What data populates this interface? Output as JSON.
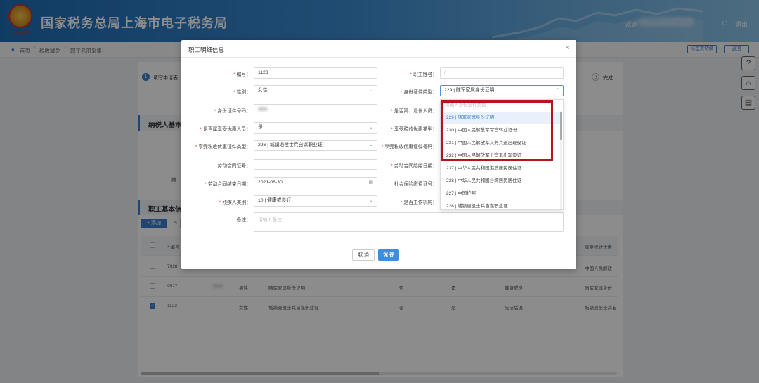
{
  "header": {
    "title": "国家税务总局上海市电子税务局",
    "emblem_text": "中国税务",
    "welcome": "欢迎",
    "logout": "退出"
  },
  "breadcrumb": {
    "items": [
      "首页",
      "税收减免",
      "职工名册采集"
    ],
    "right_buttons": [
      "标签页切换",
      "返回"
    ]
  },
  "steps": [
    {
      "num": "1",
      "label": "填写申请表"
    },
    {
      "num": "3",
      "label": "完成"
    }
  ],
  "sections": {
    "taxpayer": "纳税人基本",
    "taxpayer_row_label": "纳",
    "employee": "职工基本信",
    "add": "+ 添加"
  },
  "table": {
    "headers": [
      "* 编号",
      "享受税收优惠"
    ],
    "rows": [
      {
        "id": "7928",
        "name": "",
        "gender": "",
        "doc_type": "",
        "c5": "",
        "c6": "",
        "c7": "",
        "c8": "",
        "tail": "中国人民解放",
        "checked": false
      },
      {
        "id": "9527",
        "name": "",
        "gender": "男性",
        "doc_type": "随军家属身份证明",
        "c5": "否",
        "c6": "是",
        "c7": "健康或良",
        "c8": "",
        "tail": "随军家属身份",
        "checked": false
      },
      {
        "id": "1123",
        "name": "",
        "gender": "女性",
        "doc_type": "城镇退役士兵自谋职业证",
        "c5": "否",
        "c6": "是",
        "c7": "先证后退",
        "c8": "",
        "tail": "城镇退役士兵自",
        "checked": true
      }
    ]
  },
  "modal": {
    "title": "职工明细信息",
    "close": "×",
    "fields": {
      "number_label": "编号：",
      "number_value": "1123",
      "name_label": "职工姓名：",
      "gender_label": "性别：",
      "gender_value": "女性",
      "idtype_label": "身份证件类型：",
      "idtype_value": "229 | 随军家属身份证明",
      "idno_label": "身份证件号码：",
      "retired_label": "是否离、退休人员：",
      "preferential_label": "是否属享受优惠人员：",
      "preferential_value": "是",
      "taxpref_label": "享受税收优惠类型：",
      "prefdoc_type_label": "享受税收优惠证件类型：",
      "prefdoc_type_value": "226 | 城镇退役士兵自谋职业证",
      "prefdoc_no_label": "享受税收优惠证件号码：",
      "contract_no_label": "劳动合同证号：",
      "contract_no_value": "-",
      "contract_start_label": "劳动合同起始日期：",
      "contract_end_label": "劳动合同结束日期：",
      "contract_end_value": "2021-06-30",
      "social_label": "社会保险缴费证号：",
      "disability_label": "残疾人类别：",
      "disability_value": "10 | 健康或良好",
      "workplace_label": "是否工作机构：",
      "remark_label": "备注：",
      "remark_placeholder": "请输入备注"
    },
    "cancel": "取 消",
    "save": "保 存"
  },
  "dropdown": {
    "search_placeholder": "请输入身份证件类型",
    "options": [
      "229 | 随军家属身份证明",
      "230 | 中国人民解放军军官转业证书",
      "231 | 中国人民解放军义务兵退出现役证",
      "232 | 中国人民解放军士官退出现役证",
      "237 | 中华人民共和国港澳居民居住证",
      "238 | 中华人民共和国台湾居民居住证",
      "227 | 中国护照",
      "226 | 城镇退役士兵自谋职业证"
    ],
    "selected_index": 0,
    "highlight_color": "#b3161b"
  },
  "colors": {
    "brand": "#3b7fd0",
    "required": "#e4393c"
  }
}
